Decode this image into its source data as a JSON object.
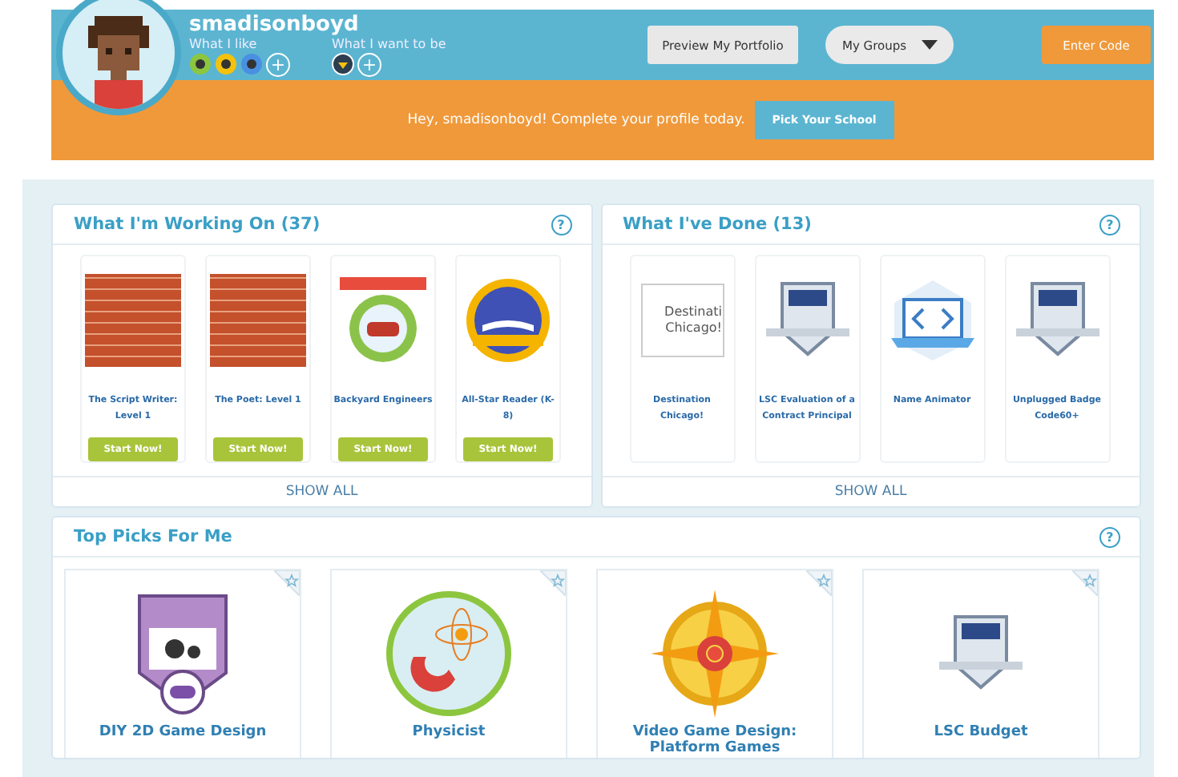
{
  "profile": {
    "username": "smadisonboyd",
    "likes_label": "What I like",
    "likes": [
      {
        "color": "#8cc63f"
      },
      {
        "color": "#f4c20d"
      },
      {
        "color": "#4a90e2"
      }
    ],
    "add_like": "+",
    "want_label": "What I want to be",
    "add_want": "+"
  },
  "header_buttons": {
    "preview": "Preview My Portfolio",
    "groups": "My Groups",
    "enter_code": "Enter Code"
  },
  "banner": {
    "message": "Hey, smadisonboyd! Complete your profile today.",
    "button": "Pick Your School"
  },
  "working": {
    "title": "What I'm Working On (37)",
    "help": "?",
    "show_all": "SHOW ALL",
    "items": [
      {
        "title": "The Script Writer: Level 1",
        "button": "Start Now!",
        "kind": "brick"
      },
      {
        "title": "The Poet: Level 1",
        "button": "Start Now!",
        "kind": "brick"
      },
      {
        "title": "Backyard Engineers",
        "button": "Start Now!",
        "kind": "seal"
      },
      {
        "title": "All-Star Reader (K-8)",
        "button": "Start Now!",
        "kind": "medal"
      }
    ]
  },
  "done": {
    "title": "What I've Done (13)",
    "help": "?",
    "show_all": "SHOW ALL",
    "items": [
      {
        "title": "Destination Chicago!",
        "kind": "broken",
        "alt": "Destinati Chicago!"
      },
      {
        "title": "LSC Evaluation of a Contract Principal",
        "kind": "shield"
      },
      {
        "title": "Name Animator",
        "kind": "code"
      },
      {
        "title": "Unplugged Badge Code60+",
        "kind": "shield"
      }
    ]
  },
  "top_picks": {
    "title": "Top Picks For Me",
    "help": "?",
    "items": [
      {
        "title": "DIY 2D Game Design",
        "kind": "game"
      },
      {
        "title": "Physicist",
        "kind": "atom"
      },
      {
        "title": "Video Game Design: Platform Games",
        "kind": "compass"
      },
      {
        "title": "LSC Budget",
        "kind": "shield"
      }
    ]
  }
}
